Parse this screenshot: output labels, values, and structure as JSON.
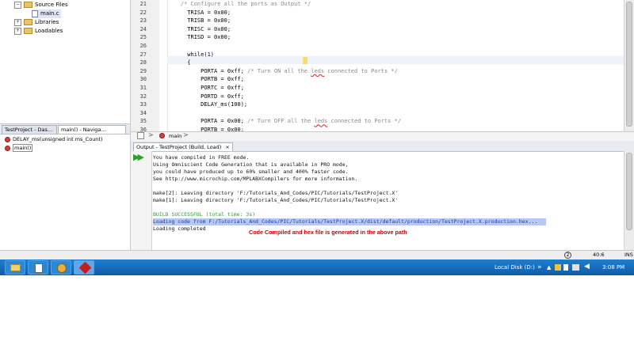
{
  "project_tree": {
    "items": [
      {
        "label": "Source Files",
        "expander": "−"
      },
      {
        "label": "main.c"
      },
      {
        "label": "Libraries",
        "expander": "+"
      },
      {
        "label": "Loadables",
        "expander": "+"
      }
    ]
  },
  "navigator": {
    "tabs": [
      "TestProject - Das...",
      "main() - Naviga..."
    ],
    "items": [
      "DELAY_ms(unsigned int ms_Count)",
      "main()"
    ]
  },
  "editor": {
    "lines": [
      {
        "num": "21",
        "text": "    /* Configure all the ports as Output */",
        "type": "comment"
      },
      {
        "num": "22",
        "text": "      TRISA = 0x00;"
      },
      {
        "num": "23",
        "text": "      TRISB = 0x00;"
      },
      {
        "num": "24",
        "text": "      TRISC = 0x00;"
      },
      {
        "num": "25",
        "text": "      TRISD = 0x00;"
      },
      {
        "num": "26",
        "text": ""
      },
      {
        "num": "27",
        "text": "      while(1)"
      },
      {
        "num": "28",
        "text": "      {"
      },
      {
        "num": "29",
        "text": "          PORTA = 0xff;",
        "comment": " /* Turn ON all the leds connected to Ports */"
      },
      {
        "num": "30",
        "text": "          PORTB = 0xff;"
      },
      {
        "num": "31",
        "text": "          PORTC = 0xff;"
      },
      {
        "num": "32",
        "text": "          PORTD = 0xff;"
      },
      {
        "num": "33",
        "text": "          DELAY_ms(100);"
      },
      {
        "num": "34",
        "text": ""
      },
      {
        "num": "35",
        "text": "          PORTA = 0x00;",
        "comment": " /* Turn OFF all the leds connected to Ports */"
      },
      {
        "num": "36",
        "text": "          PORTB = 0x00;"
      }
    ],
    "breadcrumb_function": "main"
  },
  "output": {
    "tab_label": "Output - TestProject (Build, Load)",
    "close_symbol": "×",
    "lines": [
      "You have compiled in FREE mode.",
      "Using Omniscient Code Generation that is available in PRO mode,",
      "you could have produced up to 60% smaller and 400% faster code.",
      "See http://www.microchip.com/MPLABXCompilers for more information.",
      "",
      "make[2]: Leaving directory 'F:/Tutorials_And_Codes/PIC/Tutorials/TestProject.X'",
      "make[1]: Leaving directory 'F:/Tutorials_And_Codes/PIC/Tutorials/TestProject.X'",
      "",
      "BUILD SUCCESSFUL (total time: 3s)",
      "Loading code from F:/Tutorials_And_Codes/PIC/Tutorials/TestProject.X/dist/default/production/TestProject.X.production.hex...",
      "Loading completed"
    ],
    "annotation": "Code Compiled and hex file is generated in the above path"
  },
  "status_bar": {
    "cursor_position": "40:6",
    "mode": "INS"
  },
  "taskbar": {
    "drive_label": "Local Disk (D:)",
    "time": "3:08 PM"
  },
  "colors": {
    "success": "#2aa02a",
    "link": "#1a3caa",
    "annotation": "#d10000",
    "taskbar": "#0e5ca8"
  }
}
